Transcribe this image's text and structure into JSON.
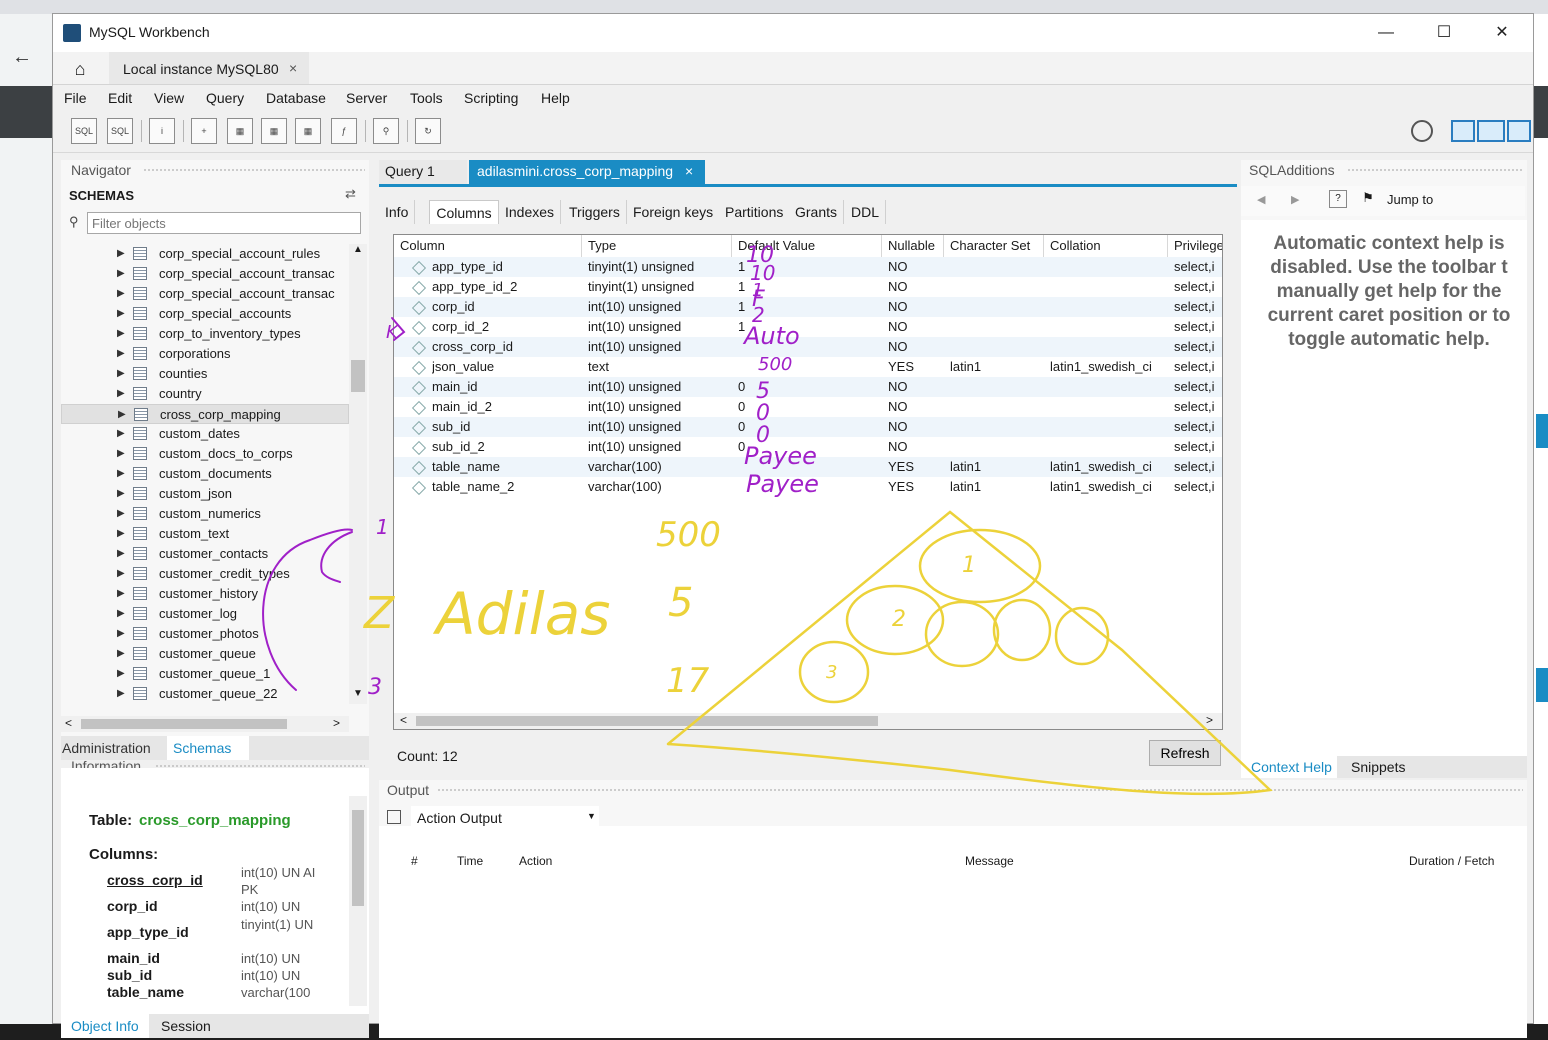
{
  "window": {
    "title": "MySQL Workbench",
    "minimize": "—",
    "maximize": "☐",
    "close": "✕"
  },
  "connection_tab": {
    "label": "Local instance MySQL80",
    "close": "×"
  },
  "menu": [
    "File",
    "Edit",
    "View",
    "Query",
    "Database",
    "Server",
    "Tools",
    "Scripting",
    "Help"
  ],
  "navigator": {
    "title": "Navigator",
    "schemas_label": "SCHEMAS",
    "filter_placeholder": "Filter objects",
    "tree_items": [
      "corp_special_account_rules",
      "corp_special_account_transac",
      "corp_special_account_transac",
      "corp_special_accounts",
      "corp_to_inventory_types",
      "corporations",
      "counties",
      "country",
      "cross_corp_mapping",
      "custom_dates",
      "custom_docs_to_corps",
      "custom_documents",
      "custom_json",
      "custom_numerics",
      "custom_text",
      "customer_contacts",
      "customer_credit_types",
      "customer_history",
      "customer_log",
      "customer_photos",
      "customer_queue",
      "customer_queue_1",
      "customer_queue_22"
    ],
    "selected_item": "cross_corp_mapping",
    "tabs": {
      "administration": "Administration",
      "schemas": "Schemas"
    }
  },
  "information": {
    "title": "Information",
    "table_label": "Table:",
    "table_name": "cross_corp_mapping",
    "columns_label": "Columns:",
    "columns": [
      {
        "name": "cross_corp_id",
        "type": "int(10) UN AI PK"
      },
      {
        "name": "corp_id",
        "type": "int(10) UN"
      },
      {
        "name": "app_type_id",
        "type": "tinyint(1) UN"
      },
      {
        "name": "main_id",
        "type": "int(10) UN"
      },
      {
        "name": "sub_id",
        "type": "int(10) UN"
      },
      {
        "name": "table_name",
        "type": "varchar(100"
      }
    ],
    "tabs": {
      "object_info": "Object Info",
      "session": "Session"
    }
  },
  "editor": {
    "doc_tabs": {
      "query1": "Query 1",
      "active": "adilasmini.cross_corp_mapping",
      "active_close": "×"
    },
    "inner_tabs": [
      "Info",
      "Columns",
      "Indexes",
      "Triggers",
      "Foreign keys",
      "Partitions",
      "Grants",
      "DDL"
    ],
    "active_inner_tab": "Columns",
    "grid_headers": [
      "Column",
      "Type",
      "Default Value",
      "Nullable",
      "Character Set",
      "Collation",
      "Privilege"
    ],
    "rows": [
      {
        "column": "app_type_id",
        "type": "tinyint(1) unsigned",
        "default": "1",
        "nullable": "NO",
        "charset": "",
        "collation": "",
        "priv": "select,i"
      },
      {
        "column": "app_type_id_2",
        "type": "tinyint(1) unsigned",
        "default": "1",
        "nullable": "NO",
        "charset": "",
        "collation": "",
        "priv": "select,i"
      },
      {
        "column": "corp_id",
        "type": "int(10) unsigned",
        "default": "1",
        "nullable": "NO",
        "charset": "",
        "collation": "",
        "priv": "select,i"
      },
      {
        "column": "corp_id_2",
        "type": "int(10) unsigned",
        "default": "1",
        "nullable": "NO",
        "charset": "",
        "collation": "",
        "priv": "select,i"
      },
      {
        "column": "cross_corp_id",
        "type": "int(10) unsigned",
        "default": "",
        "nullable": "NO",
        "charset": "",
        "collation": "",
        "priv": "select,i"
      },
      {
        "column": "json_value",
        "type": "text",
        "default": "",
        "nullable": "YES",
        "charset": "latin1",
        "collation": "latin1_swedish_ci",
        "priv": "select,i"
      },
      {
        "column": "main_id",
        "type": "int(10) unsigned",
        "default": "0",
        "nullable": "NO",
        "charset": "",
        "collation": "",
        "priv": "select,i"
      },
      {
        "column": "main_id_2",
        "type": "int(10) unsigned",
        "default": "0",
        "nullable": "NO",
        "charset": "",
        "collation": "",
        "priv": "select,i"
      },
      {
        "column": "sub_id",
        "type": "int(10) unsigned",
        "default": "0",
        "nullable": "NO",
        "charset": "",
        "collation": "",
        "priv": "select,i"
      },
      {
        "column": "sub_id_2",
        "type": "int(10) unsigned",
        "default": "0",
        "nullable": "NO",
        "charset": "",
        "collation": "",
        "priv": "select,i"
      },
      {
        "column": "table_name",
        "type": "varchar(100)",
        "default": "",
        "nullable": "YES",
        "charset": "latin1",
        "collation": "latin1_swedish_ci",
        "priv": "select,i"
      },
      {
        "column": "table_name_2",
        "type": "varchar(100)",
        "default": "",
        "nullable": "YES",
        "charset": "latin1",
        "collation": "latin1_swedish_ci",
        "priv": "select,i"
      }
    ],
    "count": "Count: 12",
    "refresh": "Refresh"
  },
  "sql_additions": {
    "title": "SQLAdditions",
    "jump_to": "Jump to",
    "help_lines": [
      "Automatic context help is",
      "disabled. Use the toolbar t",
      "manually get help for the",
      "current caret position or to",
      "toggle automatic help."
    ],
    "tabs": {
      "context_help": "Context Help",
      "snippets": "Snippets"
    }
  },
  "output": {
    "title": "Output",
    "dropdown": "Action Output",
    "headers": [
      "#",
      "Time",
      "Action",
      "Message",
      "Duration / Fetch"
    ]
  },
  "annotations": {
    "purple": [
      "10",
      "10",
      "F",
      "1",
      "2",
      "Auto",
      "K",
      "500",
      "5",
      "0",
      "0",
      "Payee",
      "Payee",
      "1",
      "3"
    ],
    "yellow": [
      "500",
      "Z",
      "Adilas",
      "5",
      "17",
      "1",
      "2",
      "3"
    ],
    "colors": {
      "purple": "#a020c8",
      "yellow": "#ecd23a"
    }
  },
  "colors": {
    "accent": "#1a8cc4",
    "info_table_name": "#2a9a2a"
  }
}
